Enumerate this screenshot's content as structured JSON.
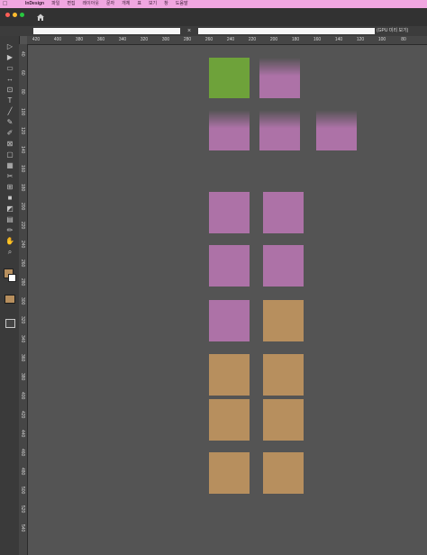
{
  "menubar": {
    "items": [
      "InDesign",
      "파일",
      "편집",
      "레이아웃",
      "문자",
      "개체",
      "표",
      "보기",
      "창",
      "도움말"
    ]
  },
  "tabbar": {
    "close_label": "×",
    "gpu_label": "(GPU 미리 보기)"
  },
  "ruler": {
    "h_ticks": [
      "420",
      "400",
      "380",
      "360",
      "340",
      "320",
      "300",
      "280",
      "260",
      "240",
      "220",
      "200",
      "180",
      "160",
      "140",
      "120",
      "100",
      "80"
    ],
    "v_ticks": [
      "40",
      "60",
      "80",
      "100",
      "120",
      "140",
      "160",
      "180",
      "200",
      "220",
      "240",
      "260",
      "280",
      "300",
      "320",
      "340",
      "360",
      "380",
      "400",
      "420",
      "440",
      "460",
      "480",
      "500",
      "520",
      "540"
    ]
  },
  "tools": [
    "selection-tool",
    "direct-selection-tool",
    "page-tool",
    "gap-tool",
    "content-collector-tool",
    "type-tool",
    "line-tool",
    "pen-tool",
    "pencil-tool",
    "rectangle-frame-tool",
    "rectangle-tool",
    "table-tool",
    "scissors-tool",
    "free-transform-tool",
    "gradient-swatch-tool",
    "gradient-feather-tool",
    "note-tool",
    "eyedropper-tool",
    "hand-tool",
    "zoom-tool"
  ],
  "colors": {
    "green": "#6ea23a",
    "pink": "#ad72a7",
    "tan": "#b78f5e",
    "menubar": "#f0a6e0"
  },
  "frames": [
    {
      "color": "green",
      "soft": false
    },
    {
      "color": "pink",
      "soft": true
    },
    {
      "color": "pink",
      "soft": true
    },
    {
      "color": "pink",
      "soft": true
    },
    {
      "color": "pink",
      "soft": true
    },
    {
      "color": "pink",
      "soft": false
    },
    {
      "color": "pink",
      "soft": false
    },
    {
      "color": "pink",
      "soft": false
    },
    {
      "color": "pink",
      "soft": false
    },
    {
      "color": "pink",
      "soft": false
    },
    {
      "color": "tan",
      "soft": false
    },
    {
      "color": "tan",
      "soft": false
    },
    {
      "color": "tan",
      "soft": false
    },
    {
      "color": "tan",
      "soft": false
    },
    {
      "color": "tan",
      "soft": false
    },
    {
      "color": "tan",
      "soft": false
    },
    {
      "color": "tan",
      "soft": false
    }
  ]
}
